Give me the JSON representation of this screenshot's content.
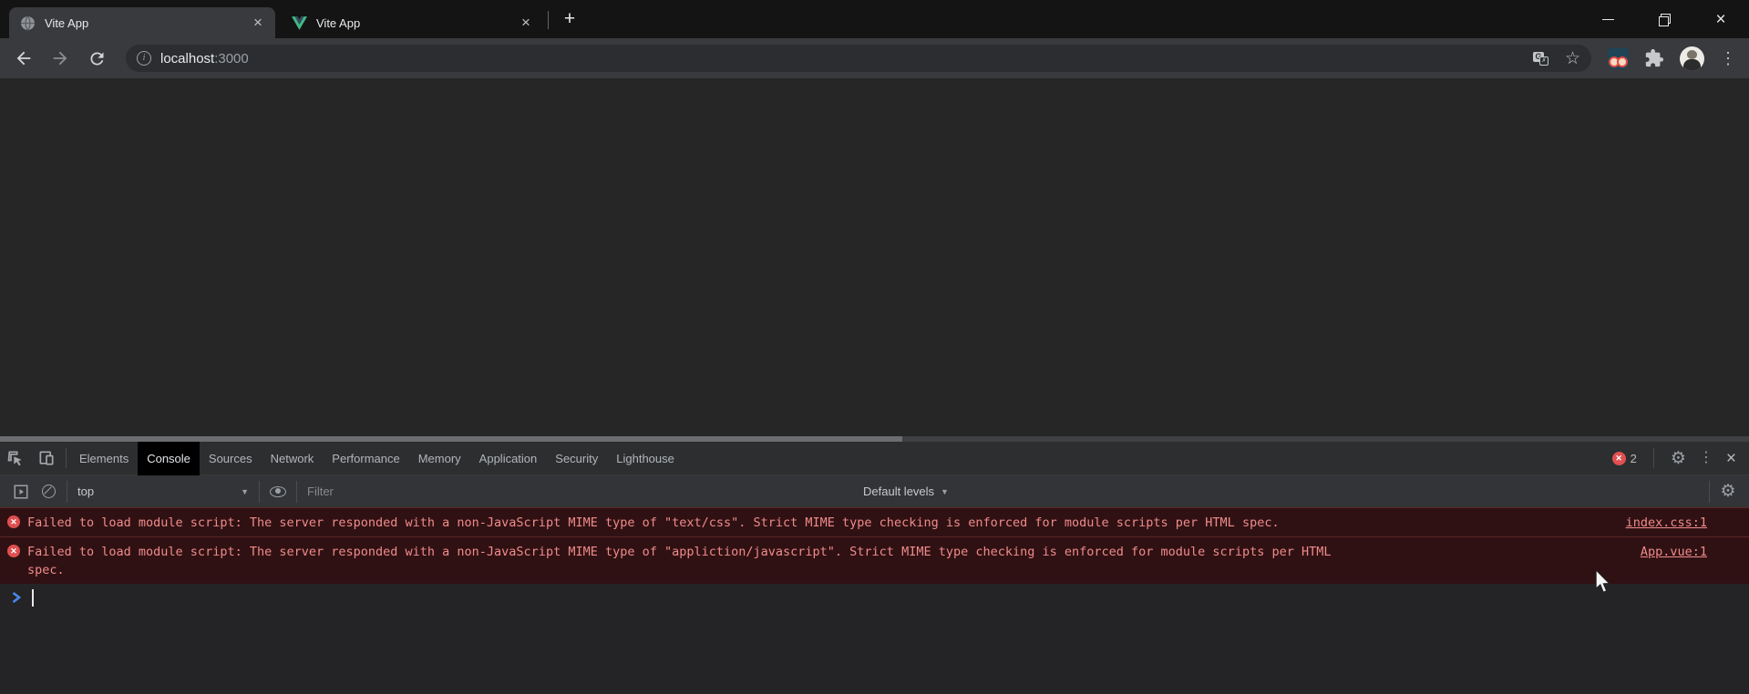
{
  "colors": {
    "error_bg": "#301113",
    "error_text": "#f08b8b",
    "error_badge": "#e05050",
    "vue_green": "#41b883",
    "vue_dark": "#35495e",
    "prompt_blue": "#4a86e8",
    "active_devtab_bg": "#000000"
  },
  "titlebar": {
    "tabs": [
      {
        "title": "Vite App",
        "favicon": "globe-icon",
        "active": true
      },
      {
        "title": "Vite App",
        "favicon": "vue-logo-icon",
        "active": false
      }
    ],
    "window_controls": {
      "close": "×"
    }
  },
  "toolbar": {
    "url": {
      "host": "localhost",
      "port": ":3000"
    }
  },
  "devtools": {
    "tabs": [
      "Elements",
      "Console",
      "Sources",
      "Network",
      "Performance",
      "Memory",
      "Application",
      "Security",
      "Lighthouse"
    ],
    "active_tab": "Console",
    "error_badge": {
      "count": "2"
    },
    "console_toolbar": {
      "context": "top",
      "filter_placeholder": "Filter",
      "levels_label": "Default levels"
    },
    "errors": [
      {
        "message": "Failed to load module script: The server responded with a non-JavaScript MIME type of \"text/css\". Strict MIME type checking is enforced for module scripts per HTML spec.",
        "source": "index.css:1"
      },
      {
        "message": "Failed to load module script: The server responded with a non-JavaScript MIME type of \"appliction/javascript\". Strict MIME type checking is enforced for module scripts per HTML spec.",
        "source": "App.vue:1"
      }
    ]
  },
  "icons": {
    "close": "×",
    "plus": "+",
    "star": "☆",
    "gear": "⚙",
    "menu_dots": "⋮",
    "dropdown_arrow": "▼",
    "error_x": "✕",
    "info": "i"
  }
}
